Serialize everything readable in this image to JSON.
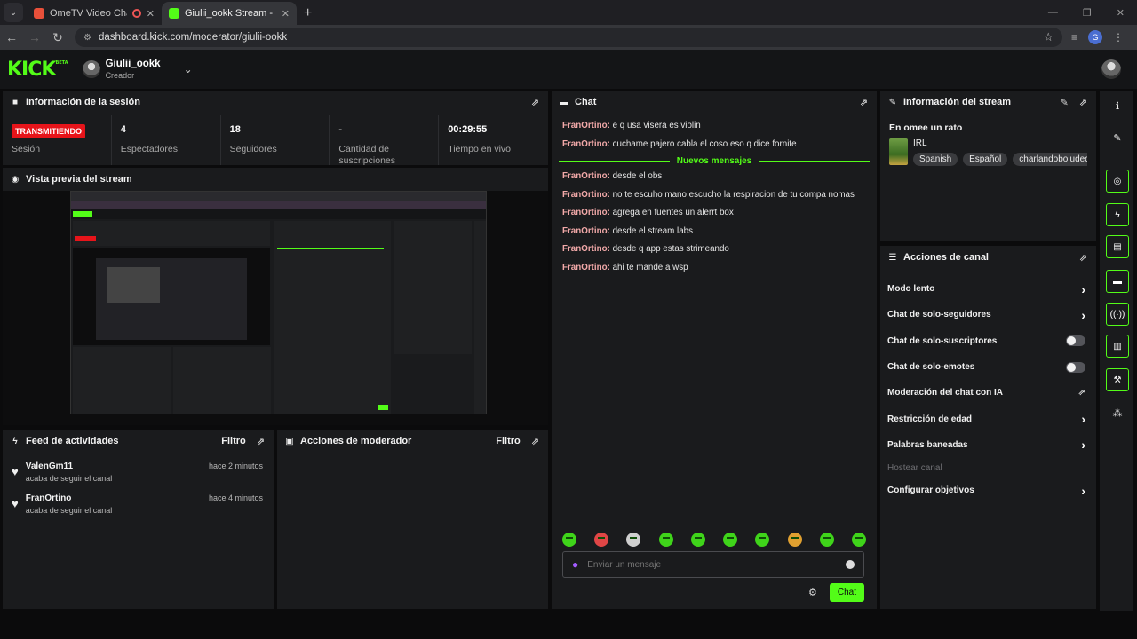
{
  "browser": {
    "tabs": [
      {
        "title": "OmeTV Video Chat — Omegle",
        "active": false
      },
      {
        "title": "Giulii_ookk Stream - Kick Dashboard",
        "active": true
      }
    ],
    "url": "dashboard.kick.com/moderator/giulii-ookk",
    "profile_initial": "G"
  },
  "header": {
    "logo": "KICK",
    "logo_badge": "BETA",
    "username": "Giulii_ookk",
    "role": "Creador"
  },
  "session": {
    "title": "Información de la sesión",
    "status_badge": "TRANSMITIENDO",
    "stats": [
      {
        "value": "",
        "label": "Sesión"
      },
      {
        "value": "4",
        "label": "Espectadores"
      },
      {
        "value": "18",
        "label": "Seguidores"
      },
      {
        "value": "-",
        "label": "Cantidad de suscripciones"
      },
      {
        "value": "00:29:55",
        "label": "Tiempo en vivo"
      }
    ]
  },
  "preview": {
    "title": "Vista previa del stream"
  },
  "activity": {
    "title": "Feed de actividades",
    "filter": "Filtro",
    "items": [
      {
        "user": "ValenGm11",
        "desc": "acaba de seguir el canal",
        "time": "hace 2 minutos"
      },
      {
        "user": "FranOrtino",
        "desc": "acaba de seguir el canal",
        "time": "hace 4 minutos"
      }
    ]
  },
  "mod_actions": {
    "title": "Acciones de moderador",
    "filter": "Filtro"
  },
  "chat": {
    "title": "Chat",
    "messages_before": [
      {
        "user": "FranOrtino:",
        "text": " e q usa visera es violin"
      },
      {
        "user": "FranOrtino:",
        "text": " cuchame pajero cabla el coso eso q dice fornite"
      }
    ],
    "new_label": "Nuevos mensajes",
    "messages_after": [
      {
        "user": "FranOrtino:",
        "text": " desde el obs"
      },
      {
        "user": "FranOrtino:",
        "text": " no te escuho mano escucho la respiracion de tu compa nomas"
      },
      {
        "user": "FranOrtino:",
        "text": " agrega en fuentes un alerrt box"
      },
      {
        "user": "FranOrtino:",
        "text": " desde el stream labs"
      },
      {
        "user": "FranOrtino:",
        "text": " desde q app estas strimeando"
      },
      {
        "user": "FranOrtino:",
        "text": " ahi te mande a wsp"
      }
    ],
    "input_placeholder": "Enviar un mensaje",
    "send_label": "Chat",
    "emote_count_colors": [
      "#3fd41a",
      "#e04646",
      "#cfcfcf",
      "#3fd41a",
      "#3fd41a",
      "#3fd41a",
      "#3fd41a",
      "#e0a030",
      "#3fd41a",
      "#3fd41a"
    ]
  },
  "stream_info": {
    "title": "Información del stream",
    "stream_title": "En omee un rato",
    "category": "IRL",
    "tags": [
      "Spanish",
      "Español",
      "charlandoboludeces"
    ]
  },
  "channel_actions": {
    "title": "Acciones de canal",
    "items": [
      {
        "label": "Modo lento",
        "control": "chevron"
      },
      {
        "label": "Chat de solo-seguidores",
        "control": "chevron"
      },
      {
        "label": "Chat de solo-suscriptores",
        "control": "toggle"
      },
      {
        "label": "Chat de solo-emotes",
        "control": "toggle"
      },
      {
        "label": "Moderación del chat con IA",
        "control": "external"
      },
      {
        "label": "Restricción de edad",
        "control": "chevron"
      },
      {
        "label": "Palabras baneadas",
        "control": "chevron"
      },
      {
        "label": "Hostear canal",
        "control": "disabled"
      },
      {
        "label": "Configurar objetivos",
        "control": "chevron"
      }
    ]
  }
}
